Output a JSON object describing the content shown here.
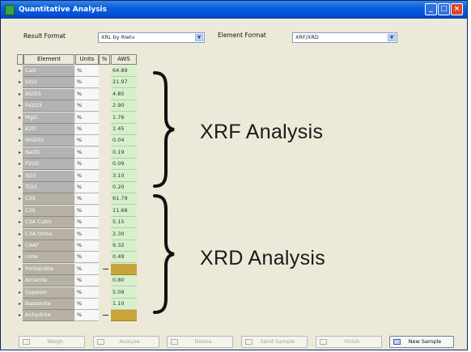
{
  "window": {
    "title": "Quantitative Analysis"
  },
  "form": {
    "result_format_label": "Result Format",
    "result_format_value": "XRL by Rietv",
    "element_format_label": "Element Format",
    "element_format_value": "XRF/XRD"
  },
  "grid": {
    "col_element": "Element",
    "col_units": "Units",
    "col_flag": "%",
    "col_value": "AWS",
    "rows": [
      {
        "element": "CaO",
        "unit": "%",
        "value": "64.89"
      },
      {
        "element": "SiO2",
        "unit": "%",
        "value": "21.97"
      },
      {
        "element": "Al2O3",
        "unit": "%",
        "value": "4.85"
      },
      {
        "element": "Fe2O3",
        "unit": "%",
        "value": "2.90"
      },
      {
        "element": "MgO",
        "unit": "%",
        "value": "1.76"
      },
      {
        "element": "K2O",
        "unit": "%",
        "value": "1.45"
      },
      {
        "element": "Mn2O3",
        "unit": "%",
        "value": "0.04"
      },
      {
        "element": "Na2O",
        "unit": "%",
        "value": "0.19"
      },
      {
        "element": "P2O5",
        "unit": "%",
        "value": "0.09"
      },
      {
        "element": "SO3",
        "unit": "%",
        "value": "3.10"
      },
      {
        "element": "TiO2",
        "unit": "%",
        "value": "0.20"
      },
      {
        "element": "C3S",
        "unit": "%",
        "value": "61.79"
      },
      {
        "element": "C2S",
        "unit": "%",
        "value": "11.68"
      },
      {
        "element": "C3A Cubic",
        "unit": "%",
        "value": "5.15"
      },
      {
        "element": "C3A Ortho",
        "unit": "%",
        "value": "2.30"
      },
      {
        "element": "C4AF",
        "unit": "%",
        "value": "9.32"
      },
      {
        "element": "Lime",
        "unit": "%",
        "value": "0.49"
      },
      {
        "element": "Portlandite",
        "unit": "%",
        "value": ""
      },
      {
        "element": "Arcanite",
        "unit": "%",
        "value": "0.80"
      },
      {
        "element": "Gypsum",
        "unit": "%",
        "value": "5.09"
      },
      {
        "element": "Bassanite",
        "unit": "%",
        "value": "1.10"
      },
      {
        "element": "Anhydrite",
        "unit": "%",
        "value": ""
      }
    ]
  },
  "annotations": {
    "xrf": "XRF Analysis",
    "xrd": "XRD Analysis"
  },
  "buttons": [
    {
      "label": "Weigh",
      "enabled": false,
      "icon": "scale-icon"
    },
    {
      "label": "Analyse",
      "enabled": false,
      "icon": "play-icon"
    },
    {
      "label": "Delete",
      "enabled": false,
      "icon": "delete-icon"
    },
    {
      "label": "Send Sample",
      "enabled": false,
      "icon": "send-icon"
    },
    {
      "label": "Finish",
      "enabled": false,
      "icon": "check-icon"
    },
    {
      "label": "New Sample",
      "enabled": true,
      "icon": "new-sample-icon"
    }
  ],
  "colors": {
    "title_bar": "#0054e3",
    "xrf_row": "#b3b3b3",
    "xrd_row": "#b7b1a4",
    "value_cell": "#d6f0cc",
    "empty_value": "#c9a43b"
  }
}
